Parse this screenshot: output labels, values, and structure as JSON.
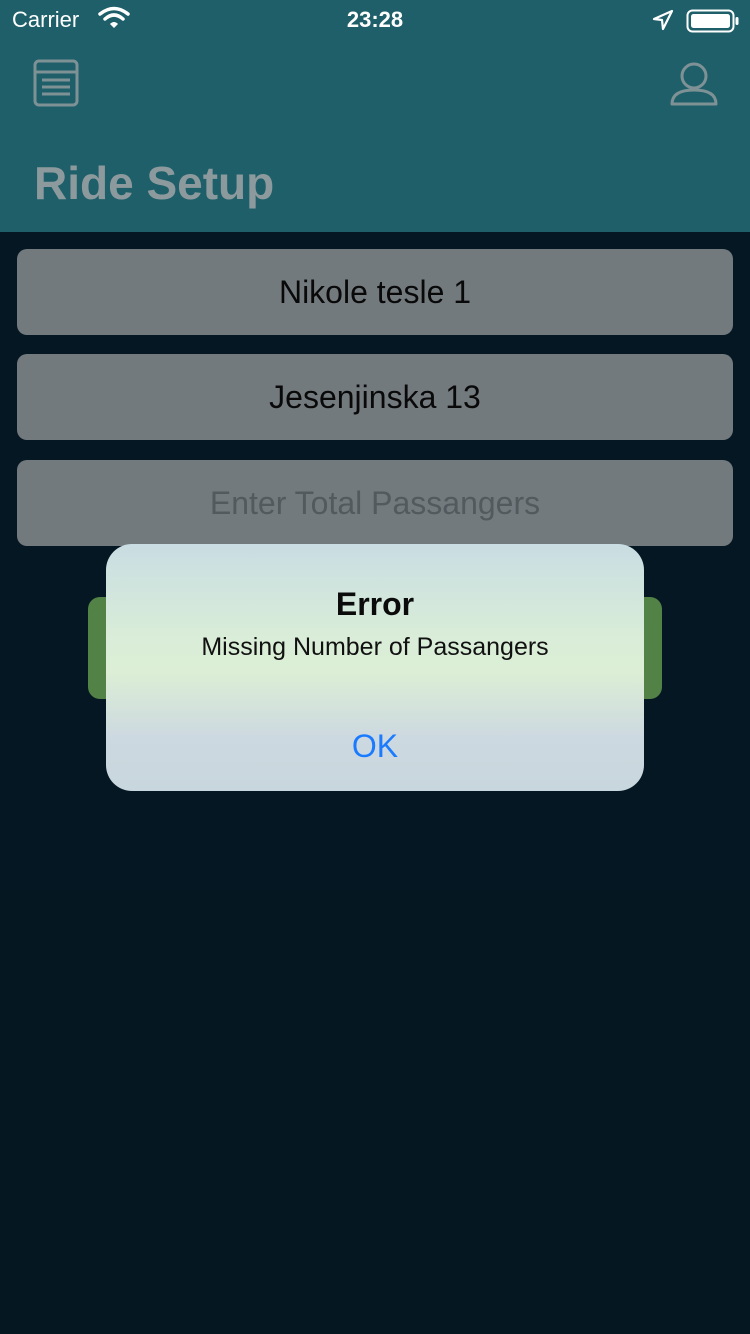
{
  "status_bar": {
    "carrier": "Carrier",
    "time": "23:28",
    "icons": [
      "wifi-icon",
      "location-icon",
      "battery-icon"
    ]
  },
  "header": {
    "title": "Ride Setup",
    "left_icon": "menu-icon",
    "right_icon": "profile-icon"
  },
  "form": {
    "pickup_value": "Nikole tesle 1",
    "destination_value": "Jesenjinska 13",
    "passengers_placeholder": "Enter Total Passangers"
  },
  "alert": {
    "title": "Error",
    "message": "Missing Number of Passangers",
    "ok_label": "OK"
  },
  "colors": {
    "header_bg": "#1e5f6a",
    "page_bg": "#061b27",
    "field_bg": "#838b90",
    "button_green": "#5e9450",
    "ok_blue": "#1b7bff"
  }
}
